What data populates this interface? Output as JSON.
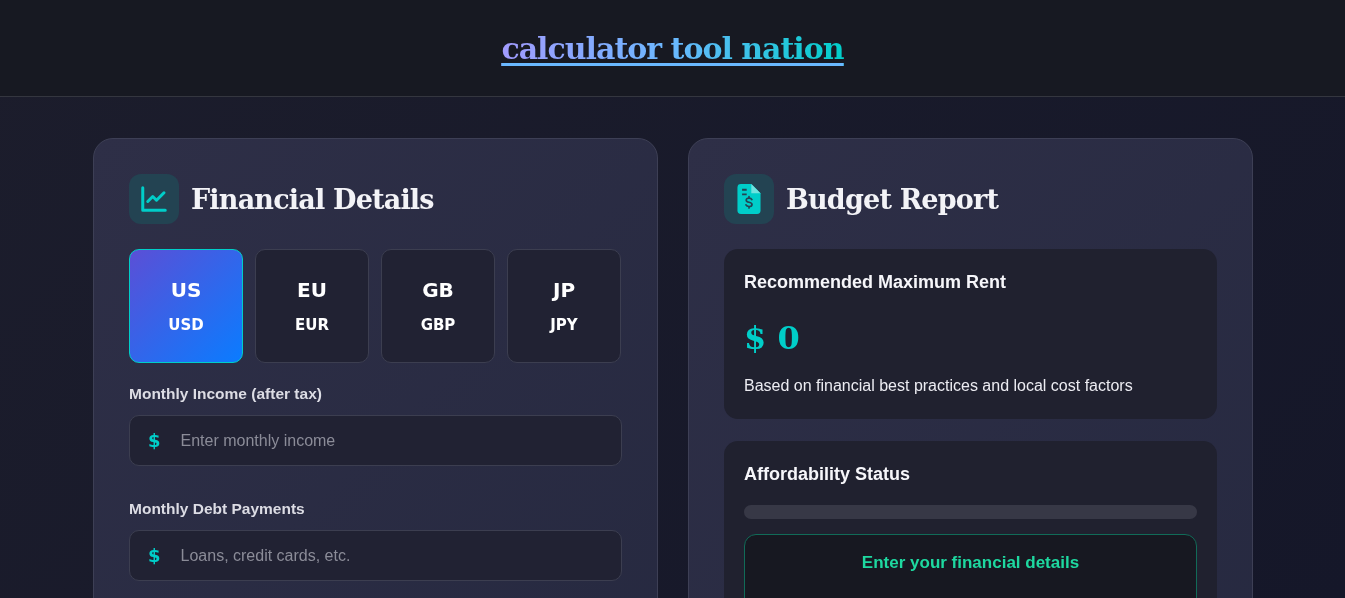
{
  "header": {
    "title": "calculator tool nation"
  },
  "financial_details": {
    "title": "Financial Details",
    "currencies": [
      {
        "code": "US",
        "currency": "USD",
        "selected": true
      },
      {
        "code": "EU",
        "currency": "EUR",
        "selected": false
      },
      {
        "code": "GB",
        "currency": "GBP",
        "selected": false
      },
      {
        "code": "JP",
        "currency": "JPY",
        "selected": false
      }
    ],
    "fields": [
      {
        "label": "Monthly Income (after tax)",
        "prefix": "$",
        "placeholder": "Enter monthly income"
      },
      {
        "label": "Monthly Debt Payments",
        "prefix": "$",
        "placeholder": "Loans, credit cards, etc."
      }
    ]
  },
  "budget_report": {
    "title": "Budget Report",
    "rent": {
      "title": "Recommended Maximum Rent",
      "value": "$ 0",
      "note": "Based on financial best practices and local cost factors"
    },
    "affordability": {
      "title": "Affordability Status",
      "level": 0,
      "status": "Enter your financial details"
    }
  }
}
